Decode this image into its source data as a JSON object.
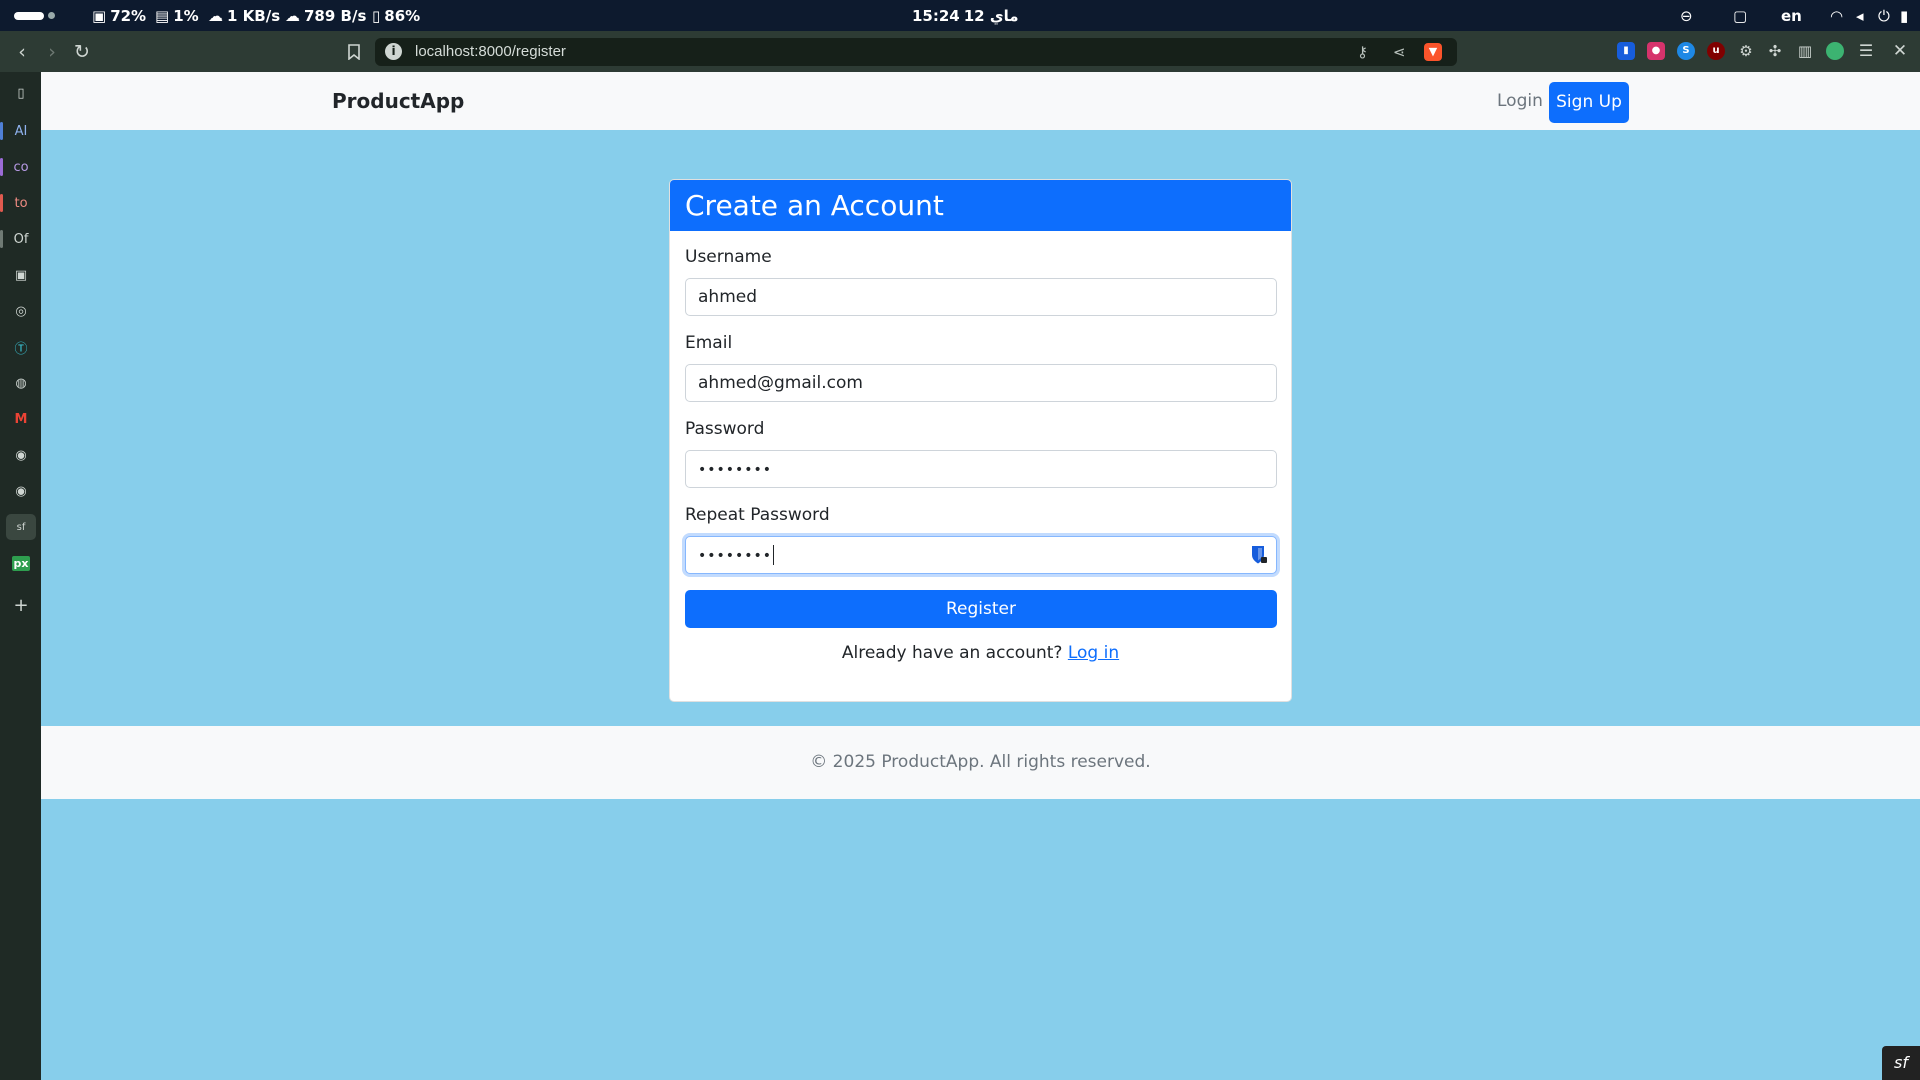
{
  "os_bar": {
    "cpu": "72%",
    "disk": "1%",
    "download": "1 KB/s",
    "upload": "789 B/s",
    "battery_small": "86%",
    "clock": "15:24",
    "date": "12 ماي",
    "language": "en"
  },
  "browser": {
    "url": "localhost:8000/register"
  },
  "sidebar": {
    "items": [
      {
        "label": "AI",
        "accent": "#4f7fd6"
      },
      {
        "label": "co",
        "accent": "#9b6bd6"
      },
      {
        "label": "to",
        "accent": "#e05a4f"
      },
      {
        "label": "Of",
        "accent": "#6f7a74"
      }
    ]
  },
  "navbar": {
    "brand": "ProductApp",
    "login": "Login",
    "signup": "Sign Up"
  },
  "form": {
    "title": "Create an Account",
    "username_label": "Username",
    "username_value": "ahmed",
    "email_label": "Email",
    "email_value": "ahmed@gmail.com",
    "password_label": "Password",
    "password_value": "••••••••",
    "repeat_label": "Repeat Password",
    "repeat_value": "••••••••",
    "submit": "Register",
    "already_text": "Already have an account?",
    "login_link": "Log in"
  },
  "footer": {
    "text": "© 2025 ProductApp. All rights reserved."
  },
  "colors": {
    "primary": "#0d6efd",
    "page_background": "#87ceeb",
    "navbar_background": "#f8f9fa"
  }
}
